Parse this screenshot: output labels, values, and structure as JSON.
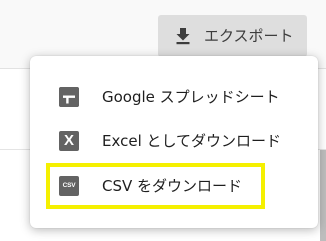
{
  "toolbar": {
    "export_label": "エクスポート",
    "export_icon": "download-icon"
  },
  "export_menu": {
    "items": [
      {
        "label": "Google スプレッドシート",
        "icon": "google-sheets-icon"
      },
      {
        "label": "Excel としてダウンロード",
        "icon": "excel-icon",
        "icon_text": "X"
      },
      {
        "label": "CSV をダウンロード",
        "icon": "csv-icon",
        "icon_text": "CSV"
      }
    ]
  },
  "highlight": {
    "target": "CSV をダウンロード",
    "color": "#f5f000"
  },
  "colors": {
    "icon_gray": "#636363",
    "button_bg": "#dedede",
    "text": "#1e1e1e"
  }
}
